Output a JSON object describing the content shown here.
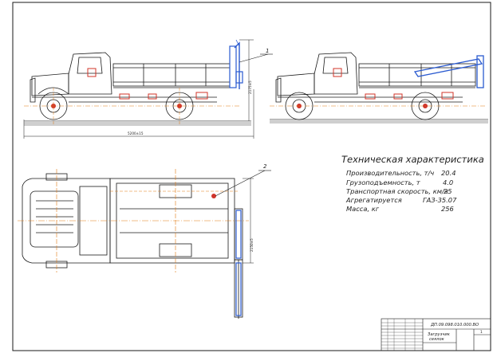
{
  "spec": {
    "title": "Техническая характеристика",
    "rows": [
      {
        "label": "Производительность, т/ч",
        "value": "20.4"
      },
      {
        "label": "Грузоподъемность, т",
        "value": "4.0"
      },
      {
        "label": "Транспортная скорость, км/ч",
        "value": "25"
      },
      {
        "label": "Агрегатируется",
        "value": "ГАЗ-35.07"
      },
      {
        "label": "Масса, кг",
        "value": "256"
      }
    ]
  },
  "callouts": {
    "one": "1",
    "two": "2"
  },
  "dims": {
    "overall_length": "5200±15",
    "height": "2175±5",
    "width": "2150±5"
  },
  "stamp": {
    "doc_code": "ДП.09.098.010.000.ВО",
    "name_line1": "Загрузчик",
    "name_line2": "сеялок",
    "sheet": "1"
  },
  "colors": {
    "line": "#1a1a1a",
    "axis": "#e07a12",
    "blue": "#2a5ad0",
    "red": "#d0342a"
  }
}
